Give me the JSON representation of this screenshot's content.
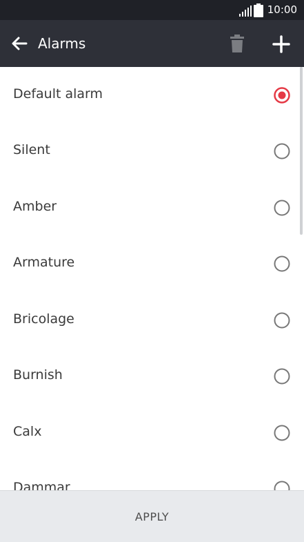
{
  "status_bar": {
    "time": "10:00"
  },
  "app_bar": {
    "title": "Alarms"
  },
  "list": {
    "items": [
      {
        "label": "Default alarm",
        "selected": true
      },
      {
        "label": "Silent",
        "selected": false
      },
      {
        "label": "Amber",
        "selected": false
      },
      {
        "label": "Armature",
        "selected": false
      },
      {
        "label": "Bricolage",
        "selected": false
      },
      {
        "label": "Burnish",
        "selected": false
      },
      {
        "label": "Calx",
        "selected": false
      },
      {
        "label": "Dammar",
        "selected": false
      }
    ]
  },
  "footer": {
    "apply_label": "APPLY"
  },
  "colors": {
    "accent": "#e53945",
    "app_bar": "#2e3038",
    "status_bar": "#1f2127"
  }
}
